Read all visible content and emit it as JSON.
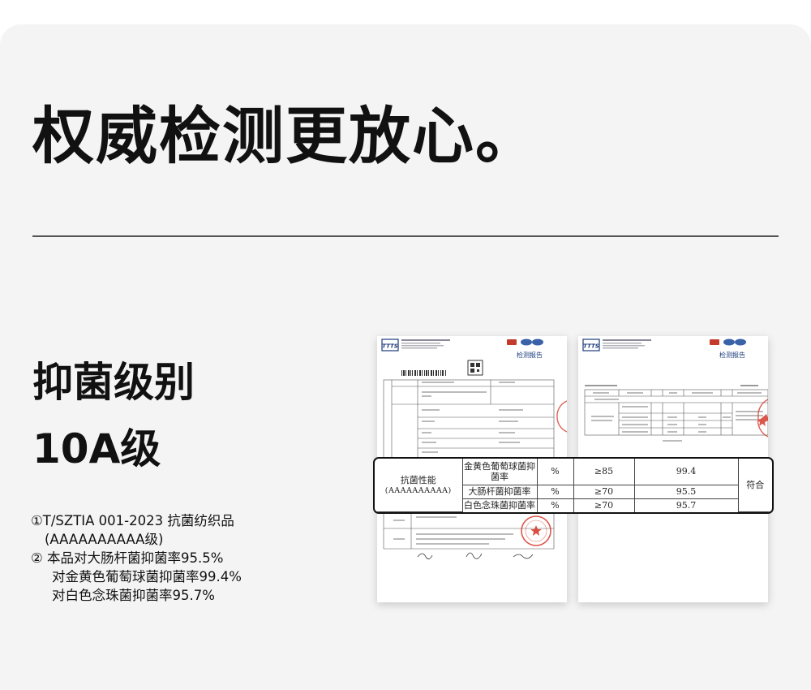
{
  "headline": "权威检测更放心。",
  "grade": {
    "label": "抑菌级别",
    "value": "10A级"
  },
  "notes": {
    "line1": "①T/SZTIA 001-2023 抗菌纺织品",
    "line1_cont": "(AAAAAAAAAA级)",
    "line2": "② 本品对大肠杆菌抑菌率95.5%",
    "line3": "对金黄色葡萄球菌抑菌率99.4%",
    "line4": "对白色念珠菌抑菌率95.7%"
  },
  "report": {
    "logo": "TTTS",
    "title": "检测报告",
    "zoom_table": {
      "item": "抗菌性能",
      "grade_code": "(AAAAAAAAAA)",
      "verdict": "符合",
      "rows": [
        {
          "name": "金黄色葡萄球菌抑菌率",
          "unit": "%",
          "requirement": "≥85",
          "result": "99.4"
        },
        {
          "name": "大肠杆菌抑菌率",
          "unit": "%",
          "requirement": "≥70",
          "result": "95.5"
        },
        {
          "name": "白色念珠菌抑菌率",
          "unit": "%",
          "requirement": "≥70",
          "result": "95.7"
        }
      ]
    }
  }
}
